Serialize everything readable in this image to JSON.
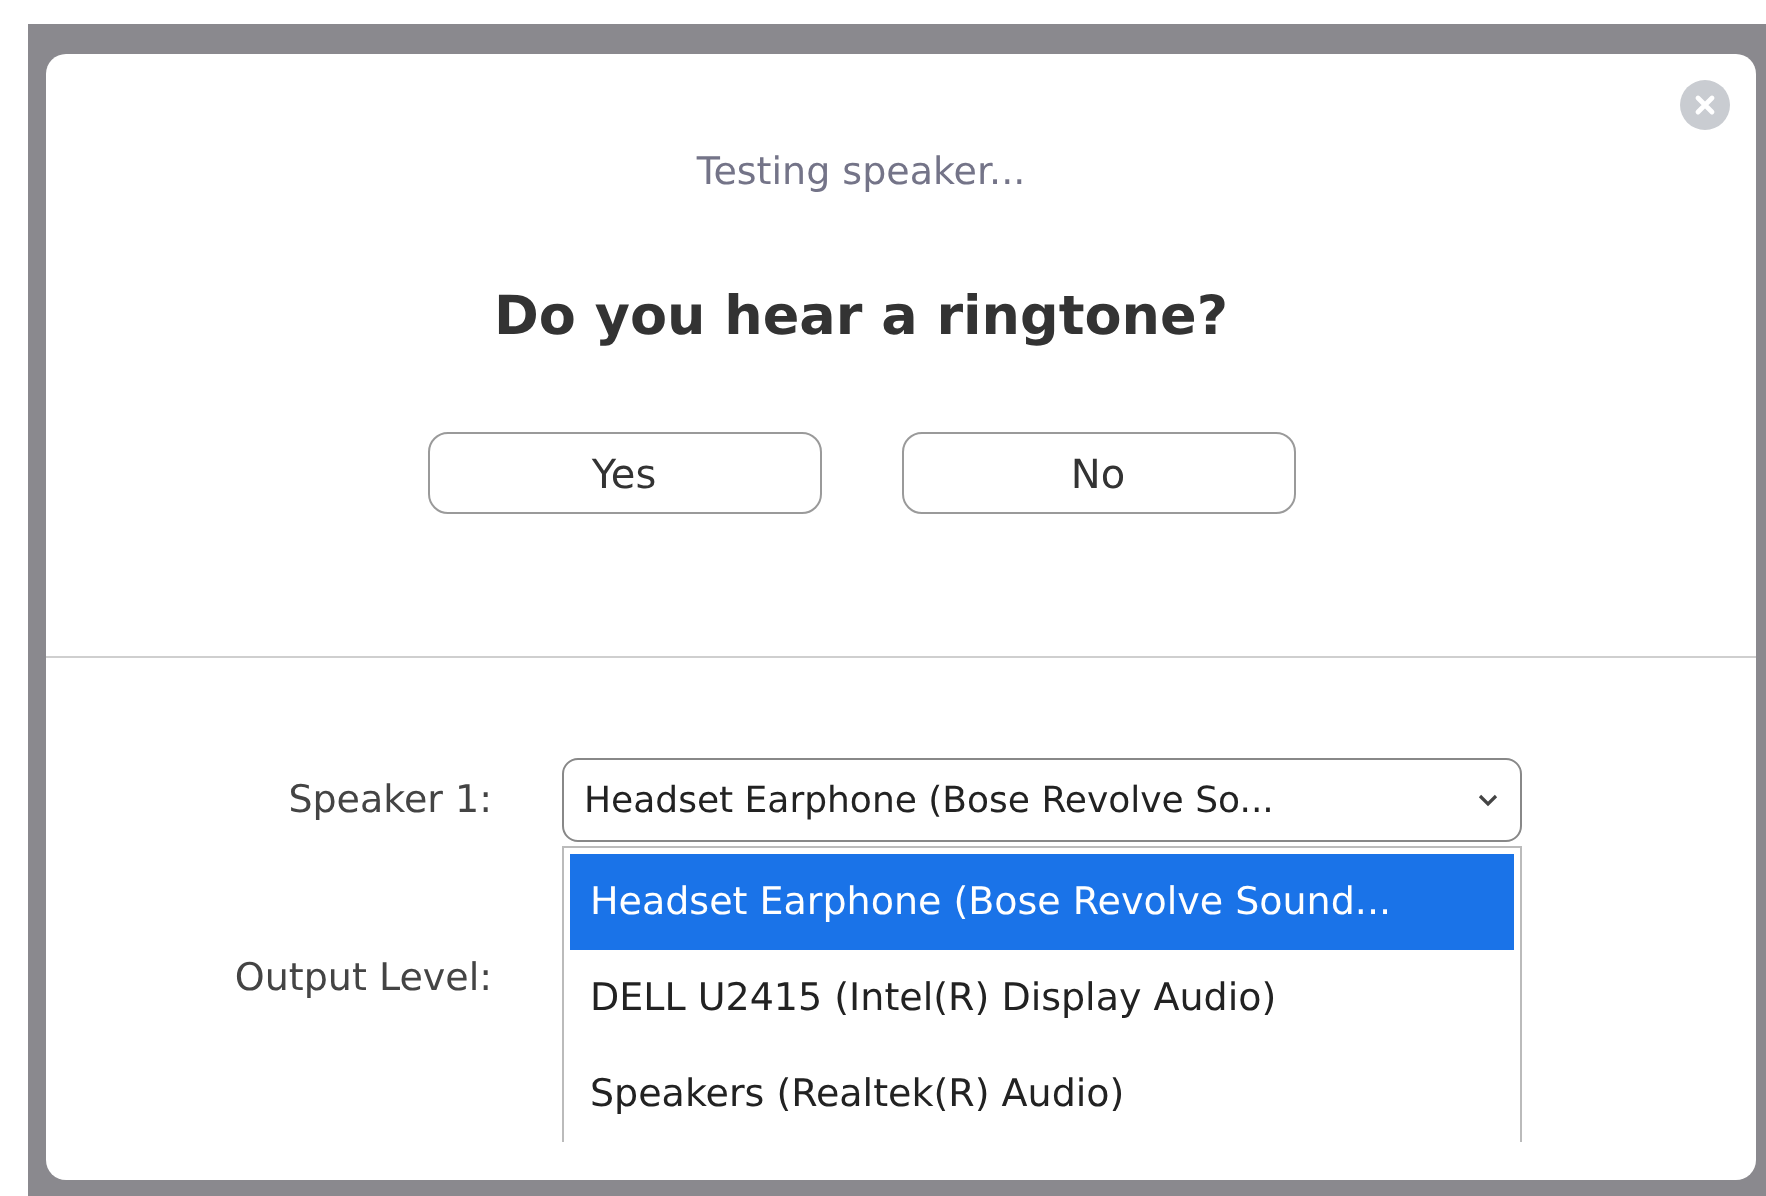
{
  "dialog": {
    "status": "Testing speaker...",
    "question": "Do you hear a ringtone?",
    "buttons": [
      "Yes",
      "No"
    ]
  },
  "speaker": {
    "label": "Speaker 1:",
    "value": "Headset Earphone (Bose Revolve So...",
    "expanded": true,
    "options": [
      {
        "label": "Headset Earphone (Bose Revolve Sound...",
        "selected": true
      },
      {
        "label": "DELL U2415 (Intel(R) Display Audio)",
        "selected": false
      },
      {
        "label": "Speakers (Realtek(R) Audio)",
        "selected": false
      }
    ]
  },
  "output_level": {
    "label": "Output Level:"
  }
}
